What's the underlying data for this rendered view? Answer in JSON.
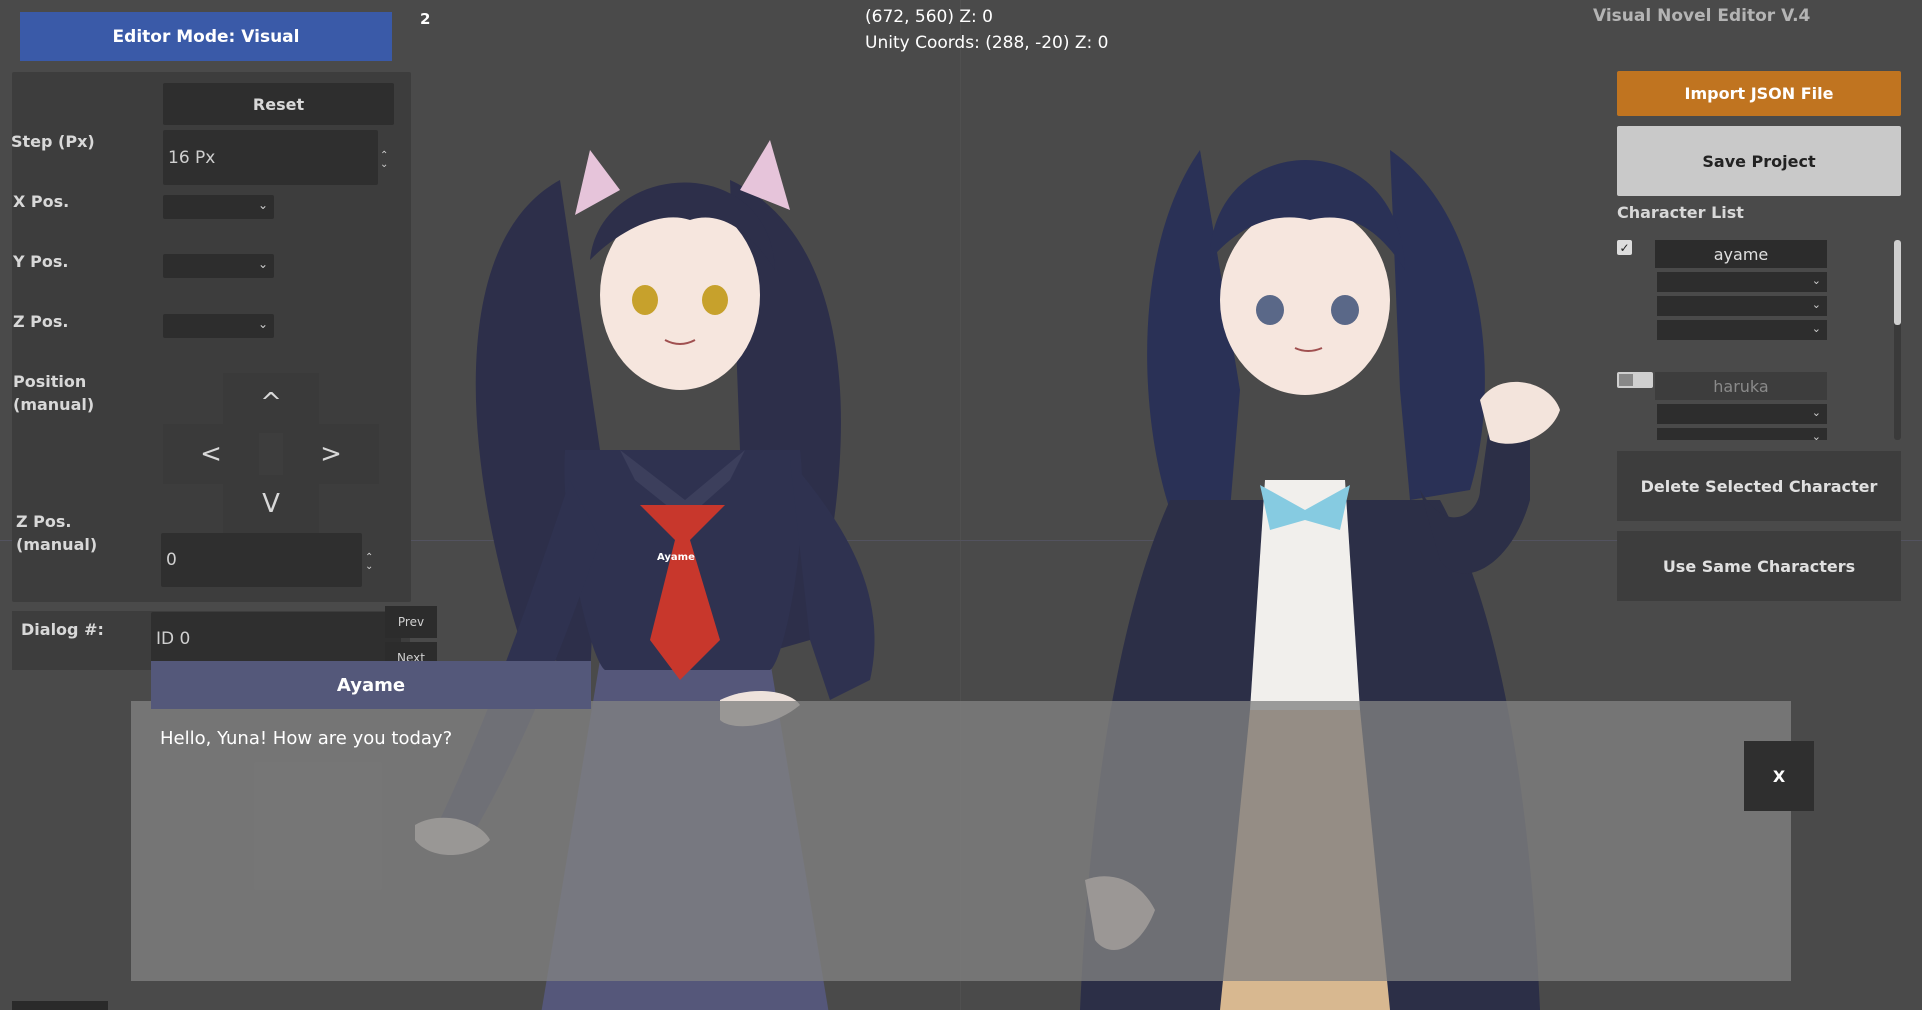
{
  "header": {
    "mode_label": "Editor Mode: Visual",
    "step_count": "2",
    "coords_line": "(672, 560) Z: 0",
    "unity_coords_line": "Unity Coords: (288, -20) Z: 0",
    "version": "Visual Novel Editor V.4"
  },
  "controls": {
    "reset_label": "Reset",
    "step_label": "Step (Px)",
    "step_value": "16 Px",
    "x_label": "X Pos.",
    "y_label": "Y Pos.",
    "z_label": "Z Pos.",
    "position_label_1": "Position",
    "position_label_2": "(manual)",
    "arrow_up": "^",
    "arrow_left": "<",
    "arrow_right": ">",
    "arrow_down": "V",
    "zpos_manual_label_1": "Z Pos.",
    "zpos_manual_label_2": "(manual)",
    "zpos_manual_value": "0"
  },
  "dialog_nav": {
    "label": "Dialog #:",
    "value": "ID 0",
    "prev_label": "Prev",
    "next_label": "Next"
  },
  "dialog": {
    "speaker": "Ayame",
    "text": "Hello, Yuna! How are you today?",
    "close_label": "X"
  },
  "scene": {
    "name_tag": "Ayame"
  },
  "right_panel": {
    "import_label": "Import JSON File",
    "save_label": "Save Project",
    "list_title": "Character List",
    "characters": [
      {
        "name": "ayame",
        "enabled": true
      },
      {
        "name": "haruka",
        "enabled": false
      }
    ],
    "delete_label": "Delete Selected Character",
    "same_label": "Use Same Characters"
  },
  "colors": {
    "mode_button": "#3a5aa8",
    "import_button": "#c07420",
    "speaker_bar": "#54587a"
  }
}
